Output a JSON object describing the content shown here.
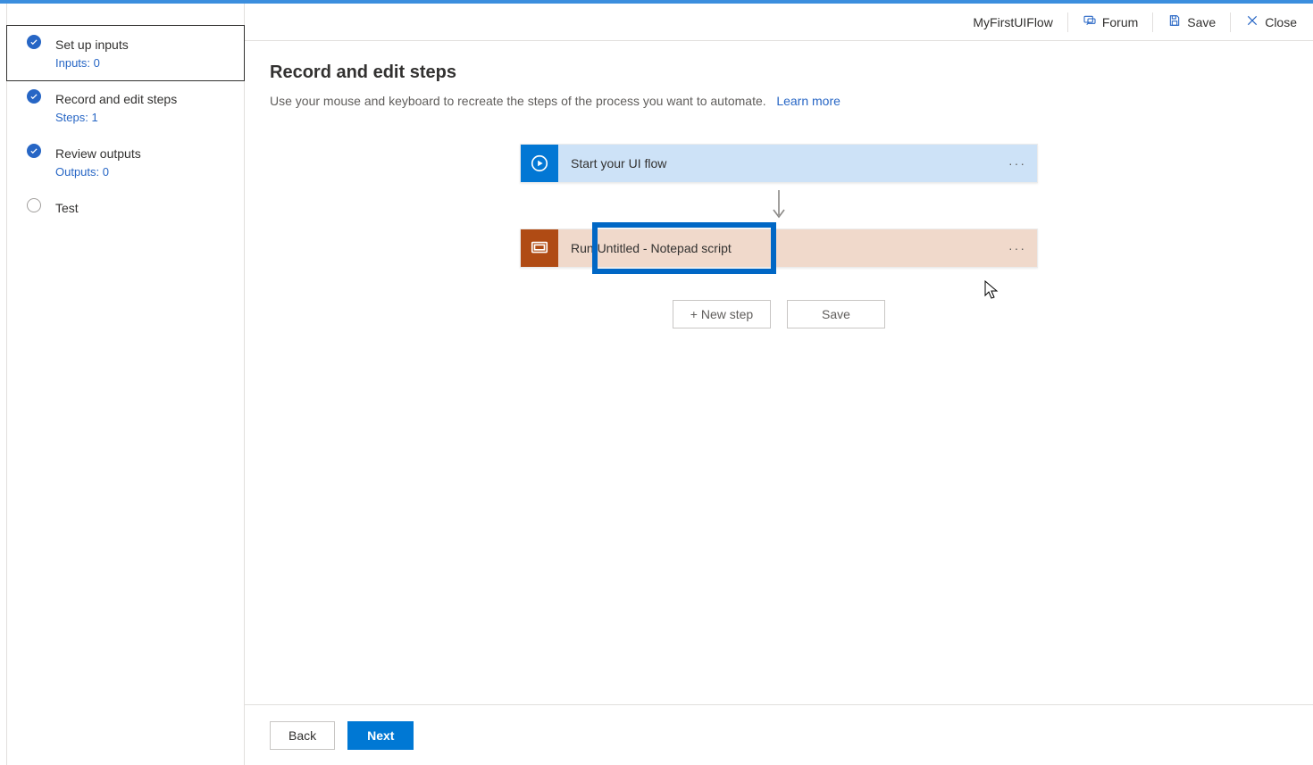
{
  "header": {
    "flow_name": "MyFirstUIFlow",
    "forum_label": "Forum",
    "save_label": "Save",
    "close_label": "Close"
  },
  "sidebar": {
    "items": [
      {
        "title": "Set up inputs",
        "sub": "Inputs: 0",
        "state": "done",
        "selected": true
      },
      {
        "title": "Record and edit steps",
        "sub": "Steps: 1",
        "state": "done",
        "selected": false
      },
      {
        "title": "Review outputs",
        "sub": "Outputs: 0",
        "state": "done",
        "selected": false
      },
      {
        "title": "Test",
        "sub": "",
        "state": "empty",
        "selected": false
      }
    ]
  },
  "page": {
    "title": "Record and edit steps",
    "description": "Use your mouse and keyboard to recreate the steps of the process you want to automate.",
    "learn_more": "Learn more"
  },
  "cards": {
    "start": {
      "label": "Start your UI flow"
    },
    "script": {
      "label": "Run Untitled - Notepad script"
    }
  },
  "actions": {
    "new_step": "+ New step",
    "save": "Save"
  },
  "footer": {
    "back": "Back",
    "next": "Next"
  }
}
